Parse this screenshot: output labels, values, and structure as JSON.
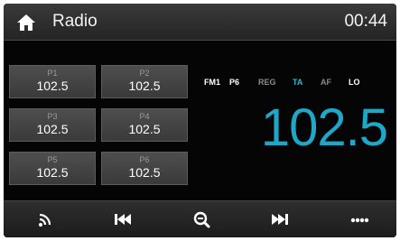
{
  "header": {
    "title": "Radio",
    "clock": "00:44"
  },
  "presets": [
    {
      "num": "P1",
      "freq": "102.5"
    },
    {
      "num": "P2",
      "freq": "102.5"
    },
    {
      "num": "P3",
      "freq": "102.5"
    },
    {
      "num": "P4",
      "freq": "102.5"
    },
    {
      "num": "P5",
      "freq": "102.5"
    },
    {
      "num": "P6",
      "freq": "102.5"
    }
  ],
  "status": {
    "band": "FM1",
    "preset": "P6",
    "reg": "REG",
    "ta": "TA",
    "af": "AF",
    "lo": "LO"
  },
  "frequency": "102.5",
  "colors": {
    "accent": "#1ea7c7",
    "active_indicator": "#2bb8d6",
    "inactive_indicator": "#8a8a8a"
  },
  "bottom_bar": {
    "icons": [
      "radio-waves-icon",
      "seek-back-icon",
      "search-icon",
      "seek-forward-icon",
      "more-icon"
    ]
  }
}
